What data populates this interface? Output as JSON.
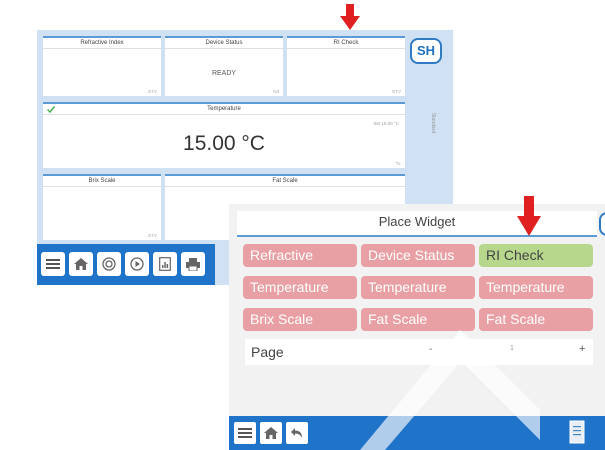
{
  "screen1": {
    "widgets": [
      {
        "title": "Refractive Index",
        "value": "",
        "foot": "ETV"
      },
      {
        "title": "Device Status",
        "value": "READY",
        "foot": "Nd"
      },
      {
        "title": "RI Check",
        "value": "",
        "foot": "ETV"
      },
      {
        "title": "Temperature",
        "value": "15.00 °C",
        "setpoint": "Set 15.00 °C",
        "foot": "TL"
      },
      {
        "title": "Brix Scale",
        "value": "",
        "foot": "ETV"
      },
      {
        "title": "Fat Scale",
        "value": "",
        "foot": ""
      }
    ],
    "brand": "SH",
    "side_label": "Standard",
    "toolbar_icons": [
      "menu-icon",
      "home-icon",
      "target-icon",
      "play-icon",
      "report-icon",
      "print-icon"
    ]
  },
  "screen2": {
    "title": "Place Widget",
    "tiles": [
      {
        "label": "Refractive",
        "state": "red"
      },
      {
        "label": "Device Status",
        "state": "red"
      },
      {
        "label": "RI Check",
        "state": "green"
      },
      {
        "label": "Temperature",
        "state": "red"
      },
      {
        "label": "Temperature",
        "state": "red"
      },
      {
        "label": "Temperature",
        "state": "red"
      },
      {
        "label": "Brix Scale",
        "state": "red"
      },
      {
        "label": "Fat Scale",
        "state": "red"
      },
      {
        "label": "Fat Scale",
        "state": "red"
      }
    ],
    "page_label": "Page",
    "page_minus": "-",
    "page_number": "1",
    "page_plus": "+",
    "toolbar_icons": [
      "menu-icon",
      "home-icon",
      "back-icon"
    ]
  },
  "colors": {
    "accent": "#1f73c8",
    "tile_red": "#e8a0a4",
    "tile_green": "#b7d88c",
    "arrow": "#e02020"
  }
}
